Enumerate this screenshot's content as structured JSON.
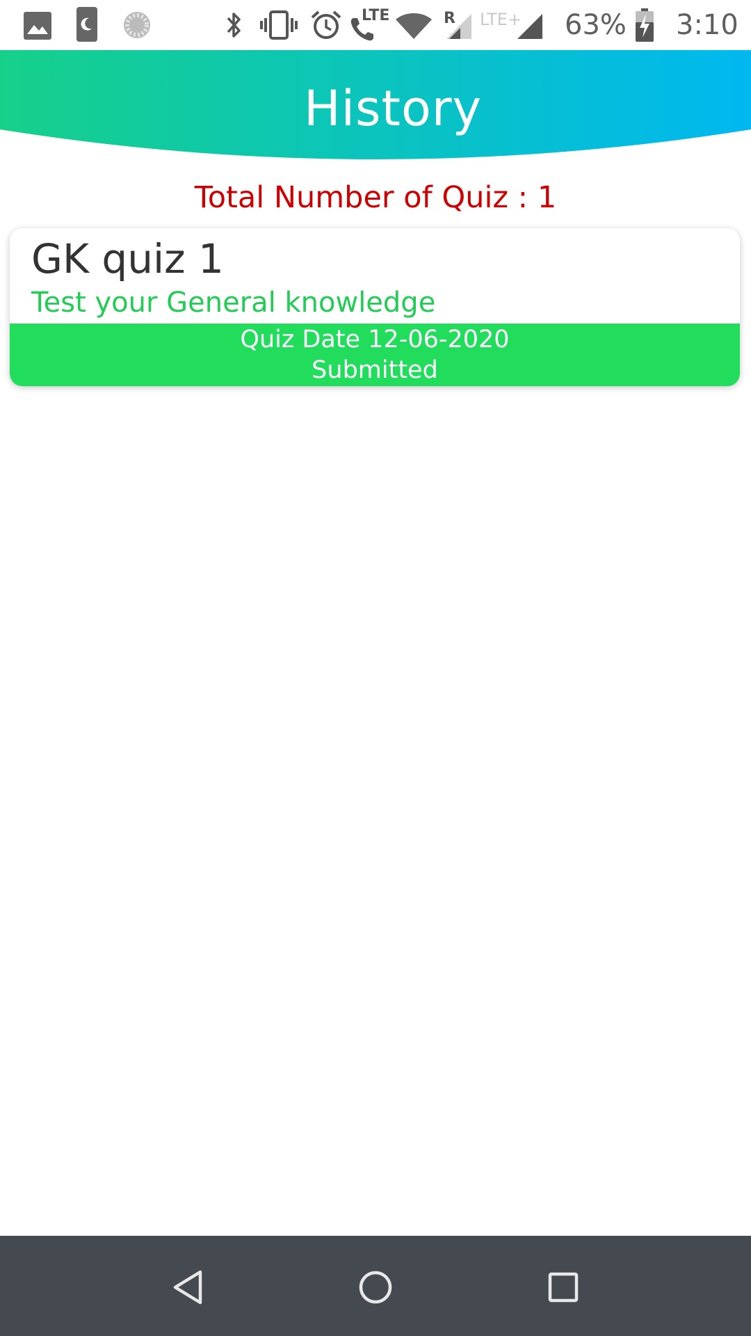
{
  "status_bar": {
    "battery_percent": "63%",
    "time": "3:10",
    "network_lte_label": "LTE",
    "network_lte_plus_label": "LTE+",
    "roaming_label": "R",
    "icons": [
      "gallery-icon",
      "do-not-disturb-icon",
      "sync-icon",
      "bluetooth-icon",
      "vibrate-icon",
      "alarm-icon",
      "volte-call-icon",
      "wifi-icon",
      "signal-icon",
      "battery-charging-icon"
    ]
  },
  "header": {
    "title": "History"
  },
  "summary": {
    "total_label": "Total Number of Quiz : 1"
  },
  "quizzes": [
    {
      "title": "GK quiz 1",
      "description": "Test your General knowledge",
      "date_label": "Quiz Date 12-06-2020",
      "status": "Submitted"
    }
  ],
  "nav_bar": {
    "icons": [
      "back-icon",
      "home-icon",
      "recents-icon"
    ]
  },
  "colors": {
    "header_gradient_start": "#16d08a",
    "header_gradient_end": "#00b8f0",
    "summary_text": "#cc0000",
    "card_description": "#22cc55",
    "card_footer": "#22dc5c",
    "nav_bar": "#454a50"
  }
}
